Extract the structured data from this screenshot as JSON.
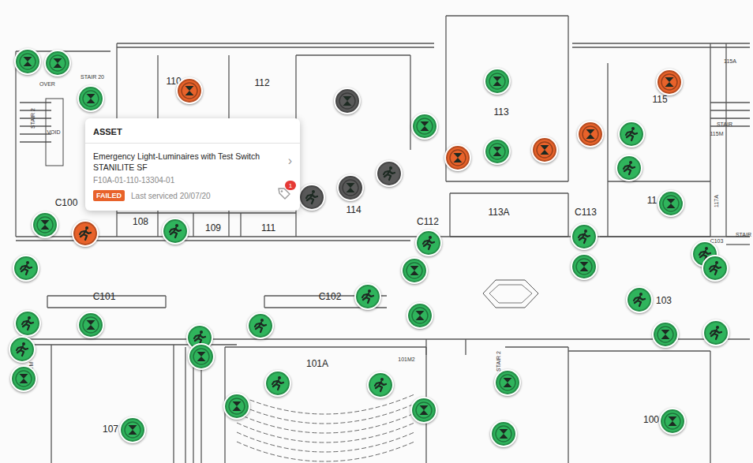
{
  "map": {
    "rooms": [
      {
        "label": "110",
        "kind": "room"
      },
      {
        "label": "112",
        "kind": "room"
      },
      {
        "label": "113",
        "kind": "room"
      },
      {
        "label": "113A",
        "kind": "room"
      },
      {
        "label": "114",
        "kind": "room"
      },
      {
        "label": "115",
        "kind": "room"
      },
      {
        "label": "115A",
        "kind": "small"
      },
      {
        "label": "115M",
        "kind": "small"
      },
      {
        "label": "117A",
        "kind": "vertical"
      },
      {
        "label": "11",
        "kind": "room"
      },
      {
        "label": "C100",
        "kind": "room"
      },
      {
        "label": "108",
        "kind": "room"
      },
      {
        "label": "109",
        "kind": "room"
      },
      {
        "label": "111",
        "kind": "room"
      },
      {
        "label": "C112",
        "kind": "room"
      },
      {
        "label": "C113",
        "kind": "room"
      },
      {
        "label": "C101",
        "kind": "room"
      },
      {
        "label": "C102",
        "kind": "room"
      },
      {
        "label": "103",
        "kind": "room"
      },
      {
        "label": "101A",
        "kind": "room"
      },
      {
        "label": "107",
        "kind": "room"
      },
      {
        "label": "100",
        "kind": "room"
      },
      {
        "label": "STAIR 20",
        "kind": "small"
      },
      {
        "label": "VOID",
        "kind": "small"
      },
      {
        "label": "OVER",
        "kind": "small"
      },
      {
        "label": "STAIR 2",
        "kind": "vertical"
      },
      {
        "label": "STAIR",
        "kind": "small"
      },
      {
        "label": "STAIR",
        "kind": "small"
      },
      {
        "label": "C103",
        "kind": "small"
      },
      {
        "label": "101M2",
        "kind": "small"
      },
      {
        "label": "STAIR 2",
        "kind": "vertical"
      },
      {
        "label": "C107M",
        "kind": "vertical"
      }
    ],
    "pins": [
      {
        "kind": "light",
        "status": "passed",
        "color": "#2fb45c"
      },
      {
        "kind": "light",
        "status": "passed",
        "color": "#2fb45c"
      },
      {
        "kind": "light",
        "status": "passed",
        "color": "#2fb45c"
      },
      {
        "kind": "light",
        "status": "failed",
        "color": "#e8622a"
      },
      {
        "kind": "light",
        "status": "inactive",
        "color": "#5a5a5a"
      },
      {
        "kind": "light",
        "status": "inactive",
        "color": "#5a5a5a"
      },
      {
        "kind": "exit",
        "status": "inactive",
        "color": "#5a5a5a"
      },
      {
        "kind": "exit",
        "status": "inactive",
        "color": "#5a5a5a"
      },
      {
        "kind": "light",
        "status": "passed",
        "color": "#2fb45c"
      },
      {
        "kind": "light",
        "status": "passed",
        "color": "#2fb45c"
      },
      {
        "kind": "light",
        "status": "passed",
        "color": "#2fb45c"
      },
      {
        "kind": "light",
        "status": "failed",
        "color": "#e8622a"
      },
      {
        "kind": "light",
        "status": "failed",
        "color": "#e8622a"
      },
      {
        "kind": "light",
        "status": "failed",
        "color": "#e8622a"
      },
      {
        "kind": "light",
        "status": "failed",
        "color": "#e8622a"
      },
      {
        "kind": "exit",
        "status": "passed",
        "color": "#2fb45c"
      },
      {
        "kind": "exit",
        "status": "passed",
        "color": "#2fb45c"
      },
      {
        "kind": "light",
        "status": "passed",
        "color": "#2fb45c"
      },
      {
        "kind": "light",
        "status": "passed",
        "color": "#2fb45c"
      },
      {
        "kind": "exit",
        "status": "failed",
        "color": "#e8622a"
      },
      {
        "kind": "exit",
        "status": "passed",
        "color": "#2fb45c"
      },
      {
        "kind": "exit",
        "status": "passed",
        "color": "#2fb45c"
      },
      {
        "kind": "exit",
        "status": "passed",
        "color": "#2fb45c"
      },
      {
        "kind": "light",
        "status": "passed",
        "color": "#2fb45c"
      },
      {
        "kind": "exit",
        "status": "passed",
        "color": "#2fb45c"
      },
      {
        "kind": "light",
        "status": "passed",
        "color": "#2fb45c"
      },
      {
        "kind": "exit",
        "status": "passed",
        "color": "#2fb45c"
      },
      {
        "kind": "exit",
        "status": "passed",
        "color": "#2fb45c"
      },
      {
        "kind": "exit",
        "status": "passed",
        "color": "#2fb45c"
      },
      {
        "kind": "light",
        "status": "passed",
        "color": "#2fb45c"
      },
      {
        "kind": "exit",
        "status": "passed",
        "color": "#2fb45c"
      },
      {
        "kind": "light",
        "status": "passed",
        "color": "#2fb45c"
      },
      {
        "kind": "exit",
        "status": "passed",
        "color": "#2fb45c"
      },
      {
        "kind": "exit",
        "status": "passed",
        "color": "#2fb45c"
      },
      {
        "kind": "light",
        "status": "passed",
        "color": "#2fb45c"
      },
      {
        "kind": "exit",
        "status": "passed",
        "color": "#2fb45c"
      },
      {
        "kind": "light",
        "status": "passed",
        "color": "#2fb45c"
      },
      {
        "kind": "exit",
        "status": "passed",
        "color": "#2fb45c"
      },
      {
        "kind": "exit",
        "status": "passed",
        "color": "#2fb45c"
      },
      {
        "kind": "light",
        "status": "passed",
        "color": "#2fb45c"
      },
      {
        "kind": "exit",
        "status": "passed",
        "color": "#2fb45c"
      },
      {
        "kind": "exit",
        "status": "passed",
        "color": "#2fb45c"
      },
      {
        "kind": "light",
        "status": "passed",
        "color": "#2fb45c"
      },
      {
        "kind": "light",
        "status": "passed",
        "color": "#2fb45c"
      },
      {
        "kind": "light",
        "status": "passed",
        "color": "#2fb45c"
      },
      {
        "kind": "light",
        "status": "passed",
        "color": "#2fb45c"
      },
      {
        "kind": "light",
        "status": "passed",
        "color": "#2fb45c"
      },
      {
        "kind": "light",
        "status": "passed",
        "color": "#2fb45c"
      }
    ]
  },
  "tooltip": {
    "heading": "ASSET",
    "title": "Emergency Light-Luminaires with Test Switch STANILITE SF",
    "code": "F10A-01-110-13304-01",
    "status": "FAILED",
    "status_color": "#e8622a",
    "serviced": "Last serviced 20/07/20",
    "badge": "1",
    "chevron": "›"
  }
}
